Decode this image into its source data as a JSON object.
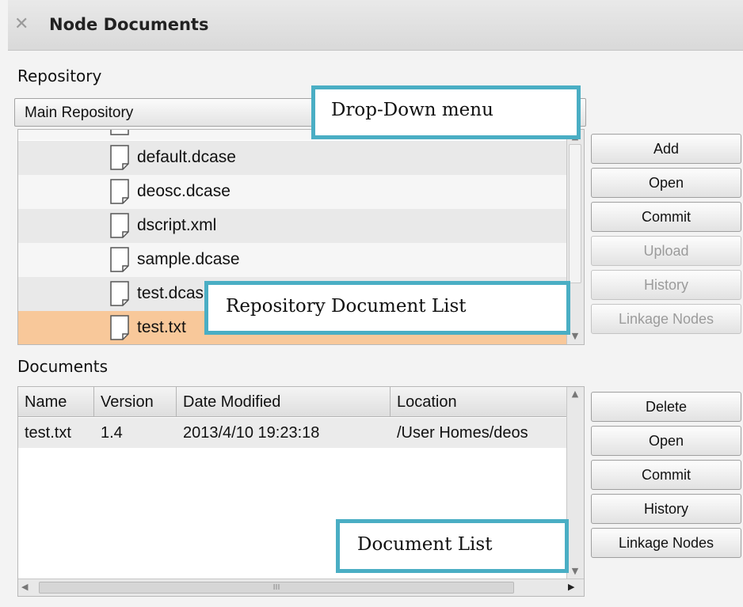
{
  "window": {
    "title": "Node Documents",
    "close_symbol": "✕"
  },
  "repository": {
    "section_label": "Repository",
    "dropdown": {
      "selected": "Main Repository"
    },
    "files": [
      {
        "name": "default.dcase",
        "selected": false
      },
      {
        "name": "deosc.dcase",
        "selected": false
      },
      {
        "name": "dscript.xml",
        "selected": false
      },
      {
        "name": "sample.dcase",
        "selected": false
      },
      {
        "name": "test.dcase",
        "selected": false
      },
      {
        "name": "test.txt",
        "selected": true
      }
    ],
    "buttons": [
      {
        "label": "Add",
        "enabled": true
      },
      {
        "label": "Open",
        "enabled": true
      },
      {
        "label": "Commit",
        "enabled": true
      },
      {
        "label": "Upload",
        "enabled": false
      },
      {
        "label": "History",
        "enabled": false
      },
      {
        "label": "Linkage Nodes",
        "enabled": false
      }
    ]
  },
  "documents": {
    "section_label": "Documents",
    "columns": [
      "Name",
      "Version",
      "Date Modified",
      "Location"
    ],
    "rows": [
      {
        "name": "test.txt",
        "version": "1.4",
        "date_modified": "2013/4/10 19:23:18",
        "location": "/User Homes/deos"
      }
    ],
    "buttons": [
      {
        "label": "Delete",
        "enabled": true
      },
      {
        "label": "Open",
        "enabled": true
      },
      {
        "label": "Commit",
        "enabled": true
      },
      {
        "label": "History",
        "enabled": true
      },
      {
        "label": "Linkage Nodes",
        "enabled": true
      }
    ]
  },
  "annotations": {
    "dropdown": "Drop-Down menu",
    "repo_list": "Repository Document List",
    "doc_list": "Document List"
  },
  "colors": {
    "accent_callout": "#4aaec4",
    "selected_row": "#f8c89a"
  },
  "icons": {
    "close": "close-icon",
    "file": "file-icon"
  }
}
